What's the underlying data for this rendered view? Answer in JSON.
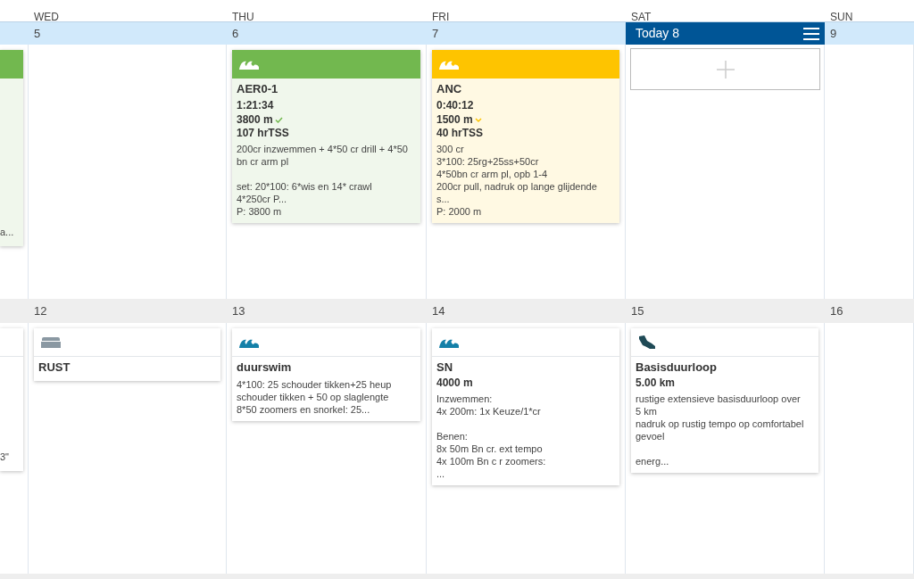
{
  "day_headers": [
    "WED",
    "THU",
    "FRI",
    "SAT",
    "SUN"
  ],
  "weeks": [
    {
      "current": true,
      "edge_card": {
        "color": "#72b84f",
        "text": "a..."
      },
      "days": [
        {
          "date": "5",
          "today": false
        },
        {
          "date": "6",
          "today": false,
          "workouts": [
            {
              "kind": "swim",
              "color": "#72b84f",
              "completed": true,
              "title": "AER0-1",
              "duration": "1:21:34",
              "distance": "3800 m",
              "tss": "107 hrTSS",
              "description": "200cr inzwemmen + 4*50 cr drill + 4*50 bn cr arm pl\n\nset: 20*100: 6*wis en 14* crawl\n4*250cr P...\nP: 3800 m"
            }
          ]
        },
        {
          "date": "7",
          "today": false,
          "workouts": [
            {
              "kind": "swim",
              "color": "#fec400",
              "completed": false,
              "title": "ANC",
              "duration": "0:40:12",
              "distance": "1500 m",
              "tss": "40 hrTSS",
              "description": "300 cr\n3*100: 25rg+25ss+50cr\n4*50bn cr arm pl, opb 1-4\n200cr pull, nadruk op lange glijdende s...\nP: 2000 m"
            }
          ]
        },
        {
          "date": "Today 8",
          "today": true
        },
        {
          "date": "9",
          "today": false
        }
      ]
    },
    {
      "current": false,
      "edge_card": {
        "text": "3\""
      },
      "days": [
        {
          "date": "12",
          "today": false,
          "workouts": [
            {
              "kind": "rest",
              "title": "RUST"
            }
          ]
        },
        {
          "date": "13",
          "today": false,
          "workouts": [
            {
              "kind": "swim",
              "title": "duurswim",
              "description": "4*100: 25 schouder tikken+25 heup schouder tikken + 50 op slaglengte\n8*50 zoomers en snorkel: 25..."
            }
          ]
        },
        {
          "date": "14",
          "today": false,
          "workouts": [
            {
              "kind": "swim",
              "title": "SN",
              "distance": "4000 m",
              "description": "Inzwemmen:\n4x 200m: 1x Keuze/1*cr\n\nBenen:\n8x 50m Bn cr. ext tempo\n4x 100m Bn c r zoomers:\n..."
            }
          ]
        },
        {
          "date": "15",
          "today": false,
          "workouts": [
            {
              "kind": "run",
              "title": "Basisduurloop",
              "distance": "5.00 km",
              "description": "rustige extensieve basisduurloop over 5 km\nnadruk op rustig tempo op comfortabel gevoel\n\nenerg..."
            }
          ]
        },
        {
          "date": "16",
          "today": false
        }
      ]
    }
  ]
}
